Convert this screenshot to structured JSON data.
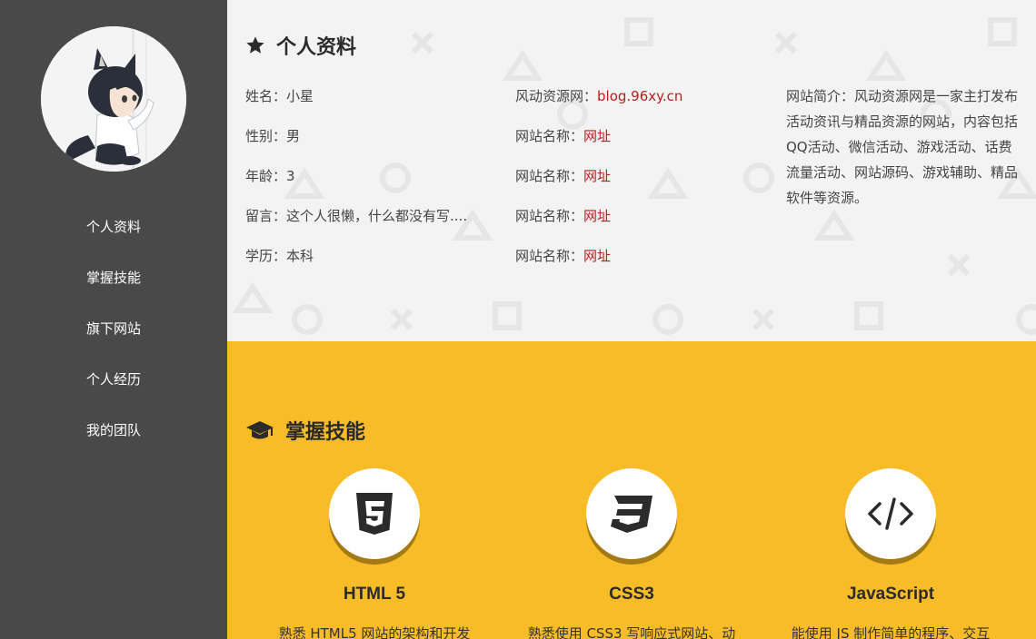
{
  "sidebar": {
    "items": [
      {
        "label": "个人资料"
      },
      {
        "label": "掌握技能"
      },
      {
        "label": "旗下网站"
      },
      {
        "label": "个人经历"
      },
      {
        "label": "我的团队"
      }
    ]
  },
  "profile": {
    "title": "个人资料",
    "col1": [
      {
        "key": "姓名：",
        "value": "小星"
      },
      {
        "key": "性别：",
        "value": "男"
      },
      {
        "key": "年龄：",
        "value": "3"
      },
      {
        "key": "留言：",
        "value": "这个人很懒，什么都没有写...."
      },
      {
        "key": "学历：",
        "value": "本科"
      }
    ],
    "col2": [
      {
        "key": "风动资源网：",
        "value": "blog.96xy.cn"
      },
      {
        "key": "网站名称：",
        "value": "网址"
      },
      {
        "key": "网站名称：",
        "value": "网址"
      },
      {
        "key": "网站名称：",
        "value": "网址"
      },
      {
        "key": "网站名称：",
        "value": "网址"
      }
    ],
    "intro": "网站简介：风动资源网是一家主打发布活动资讯与精品资源的网站，内容包括QQ活动、微信活动、游戏活动、话费流量活动、网站源码、游戏辅助、精品软件等资源。"
  },
  "skills": {
    "title": "掌握技能",
    "items": [
      {
        "name": "HTML 5",
        "desc": "熟悉 HTML5 网站的架构和开发",
        "icon": "html5-icon"
      },
      {
        "name": "CSS3",
        "desc": "熟悉使用 CSS3 写响应式网站、动",
        "icon": "css3-icon"
      },
      {
        "name": "JavaScript",
        "desc": "能使用 JS 制作简单的程序、交互",
        "icon": "code-icon"
      }
    ]
  },
  "colors": {
    "sidebar": "#494949",
    "profile_bg": "#f3f3f3",
    "skills_bg": "#f8bc28",
    "link": "#b3201e"
  }
}
